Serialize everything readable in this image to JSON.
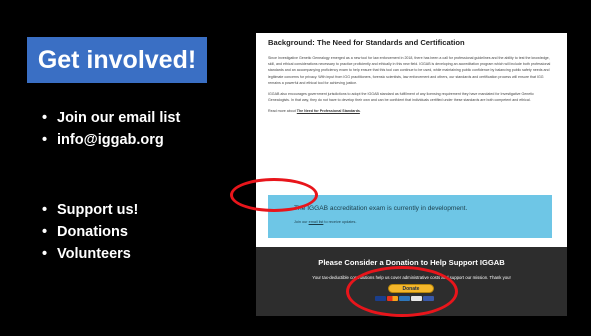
{
  "slide": {
    "title": "Get involved!",
    "bullets_top": [
      "Join our email list",
      "info@iggab.org"
    ],
    "bullets_bottom": [
      "Support us!",
      "Donations",
      "Volunteers"
    ]
  },
  "website": {
    "heading": "Background: The Need for Standards and Certification",
    "paragraph1": "Since Investigative Genetic Genealogy emerged as a new tool for law enforcement in 2018, there has been a call for professional guidelines and the ability to test the knowledge, skill, and ethical considerations necessary to practice proficiently and ethically in this new field. IGGAB is developing an accreditation program which will include both professional standards and an accompanying proficiency exam to help ensure that this tool can continue to be used, while maintaining public confidence by balancing public safety needs and legitimate concerns for privacy. With input from IGG practitioners, forensic scientists, law enforcement and others, our standards and certification process will ensure that IGG remains a powerful and ethical tool for achieving justice.",
    "paragraph2": "IGGAB also encourages government jurisdictions to adopt the IGGAB standard as fulfillment of any licensing requirement they have mandated for Investigative Genetic Genealogists. In that way, they do not have to develop their own and can be confident that individuals certified under these standards are both competent and ethical.",
    "read_more_prefix": "Read more about ",
    "read_more_link": "The Need for Professional Standards",
    "read_more_suffix": ".",
    "notice": {
      "title": "The IGGAB accreditation exam is currently in development.",
      "sub_prefix": "Join our ",
      "sub_link": "email list",
      "sub_suffix": " to receive updates."
    },
    "donation": {
      "title": "Please Consider a Donation to Help Support IGGAB",
      "subtitle": "Your tax-deductible contributions help us cover administrative costs and support our mission. Thank you!",
      "button_label": "Donate"
    }
  },
  "colors": {
    "title_bg": "#3a6fc4",
    "notice_bg": "#6ec6e6",
    "donation_bg": "#2d2d2d",
    "donate_button": "#f5b72b",
    "highlight_circle": "#e8151b"
  },
  "icons": {
    "payment_cards": [
      "visa-card-icon",
      "mastercard-icon",
      "amex-card-icon",
      "discover-card-icon",
      "bank-card-icon"
    ]
  }
}
